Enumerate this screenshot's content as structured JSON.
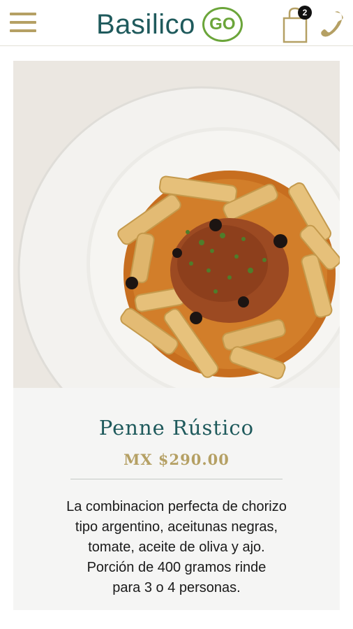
{
  "header": {
    "brand_name": "Basilico",
    "brand_badge": "GO",
    "cart_count": "2",
    "icons": [
      "menu-icon",
      "shopping-bag-icon",
      "phone-icon"
    ],
    "colors": {
      "gold": "#b5a064",
      "teal": "#1f5a5c",
      "green": "#6ba53a"
    }
  },
  "product": {
    "name": "Penne Rústico",
    "price": "MX $290.00",
    "description": "La combinacion perfecta de chorizo\ntipo argentino, aceitunas negras,\ntomate, aceite de oliva y ajo.\nPorción de 400 gramos rinde\npara 3 o 4 personas."
  }
}
